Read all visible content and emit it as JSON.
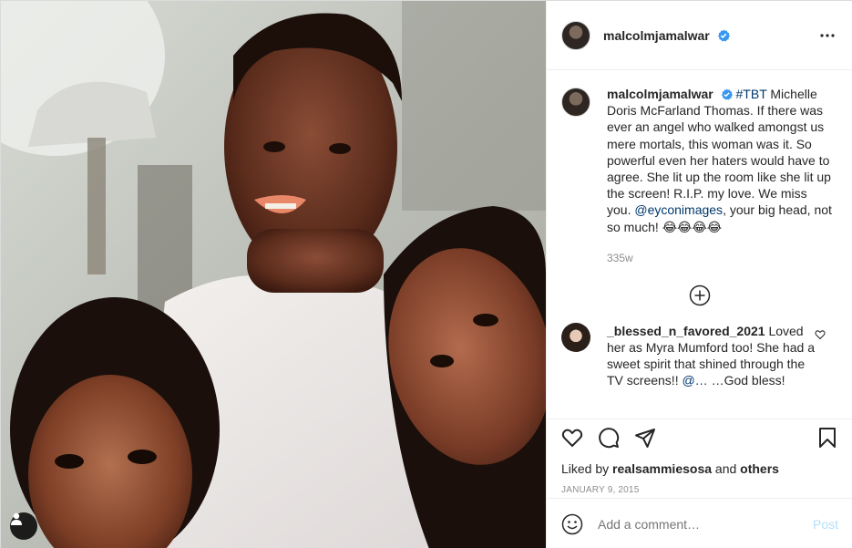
{
  "post": {
    "username": "malcolmjamalwar",
    "verified": true,
    "more_icon": "ellipsis-icon",
    "caption": {
      "username": "malcolmjamalwar",
      "hashtag": "#TBT",
      "text_1": " Michelle Doris McFarland Thomas. If there was ever an angel who walked amongst us mere mortals, this woman was it. So powerful even her haters would have to agree. She lit up the room like she lit up the screen! R.I.P. my love. We miss you. ",
      "mention": "@eyconimages",
      "text_2": ", your big head, not so much! 😂😂😂😂",
      "time": "335w"
    },
    "load_more_icon": "plus-circle-icon",
    "comments": [
      {
        "username": "_blessed_n_favored_2021",
        "text": " Loved her as Myra Mumford too! She had a sweet spirit that shined through the TV screens!! ",
        "mention": "@…",
        "text_2": " …God bless!"
      }
    ],
    "likes": {
      "prefix": "Liked by ",
      "user": "realsammiesosa",
      "middle": " and ",
      "others": "others"
    },
    "date": "JANUARY 9, 2015",
    "add_comment": {
      "placeholder": "Add a comment…",
      "post_label": "Post"
    },
    "colors": {
      "verified": "#3897f0",
      "link": "#00376b",
      "muted": "#8e8e8e",
      "post_disabled": "#b2dffc"
    }
  }
}
